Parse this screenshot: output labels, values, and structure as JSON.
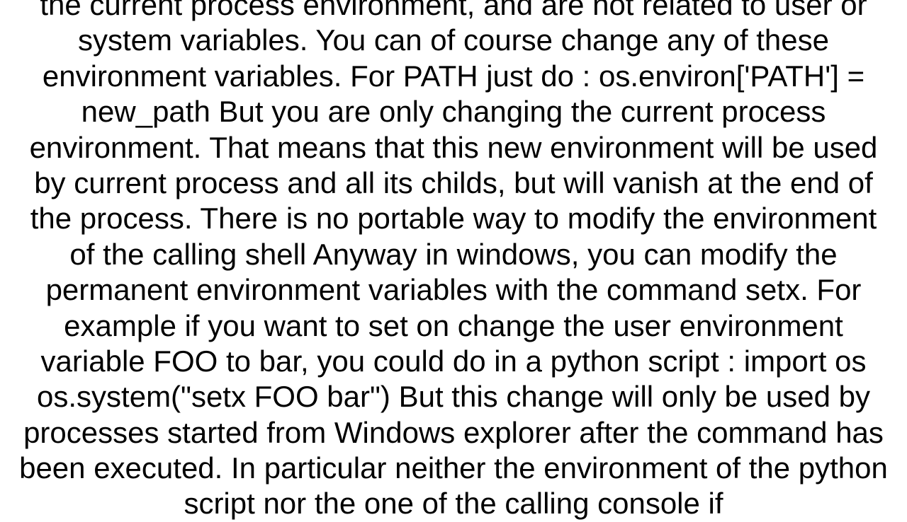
{
  "document": {
    "body_text": "the current process environment, and are not related to user or system variables. You can of course change any of these environment variables. For PATH just do : os.environ['PATH'] = new_path  But you are only changing the current process environment. That means that this new environment will be used by current process and all its childs, but will vanish at the end of the process. There is no portable way to modify the environment of the calling shell Anyway in windows, you can modify the permanent environment variables with the command setx. For example if you want to set on change the user environment variable FOO to bar, you could do in a python script : import os os.system(\"setx FOO bar\")  But this change will only be used by processes started from Windows explorer after the command has been executed. In particular neither the environment of the python script nor the one of the calling console if"
  }
}
